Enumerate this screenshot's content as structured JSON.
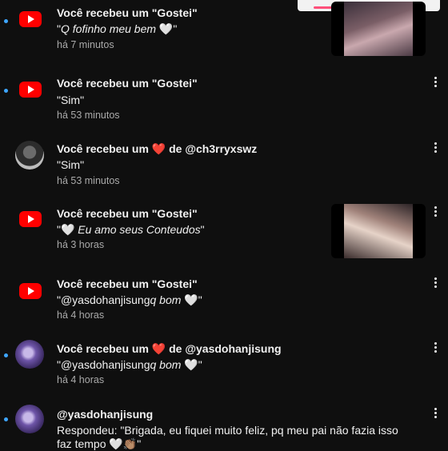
{
  "notifications": [
    {
      "type": "youtube",
      "unread": true,
      "title": "Você recebeu um \"Gostei\"",
      "text_prefix": "\"",
      "text_italic": "Q fofinho meu bem",
      "text_suffix": " 🤍\"",
      "time": "há 7 minutos",
      "thumbnail": true
    },
    {
      "type": "youtube",
      "unread": true,
      "title": "Você recebeu um \"Gostei\"",
      "text": "\"Sim\"",
      "time": "há 53 minutos"
    },
    {
      "type": "user",
      "title_start": "Você recebeu um ",
      "title_heart": "❤️",
      "title_end": " de @ch3rryxswz",
      "text": "\"Sim\"",
      "time": "há 53 minutos"
    },
    {
      "type": "youtube",
      "title": "Você recebeu um \"Gostei\"",
      "text_prefix": "\"🤍 ",
      "text_italic": "Eu amo seus Conteudos",
      "text_suffix": "\"",
      "time": "há 3 horas",
      "thumbnail": true
    },
    {
      "type": "youtube",
      "title": "Você recebeu um \"Gostei\"",
      "text_prefix": "\"@yasdohanjisung",
      "text_italic": "q bom",
      "text_suffix": " 🤍\"",
      "time": "há 4 horas"
    },
    {
      "type": "user",
      "unread": true,
      "title_start": "Você recebeu um ",
      "title_heart": "❤️",
      "title_end": " de @yasdohanjisung",
      "text_prefix": "\"@yasdohanjisung",
      "text_italic": "q bom",
      "text_suffix": " 🤍\"",
      "time": "há 4 horas"
    },
    {
      "type": "user",
      "unread": true,
      "title": "@yasdohanjisung",
      "text_line1": "Respondeu: \"Brigada, eu fiquei muito feliz, pq meu pai não fazia isso",
      "text_line2": "faz tempo 🤍👏🏽\""
    }
  ],
  "colors": {
    "background": "#0f0f0f",
    "youtube_red": "#ff0000",
    "unread_dot": "#3ea6ff",
    "secondary_text": "#aaaaaa"
  },
  "icons": [
    "youtube-icon",
    "more-vert-icon",
    "heart-icon"
  ]
}
